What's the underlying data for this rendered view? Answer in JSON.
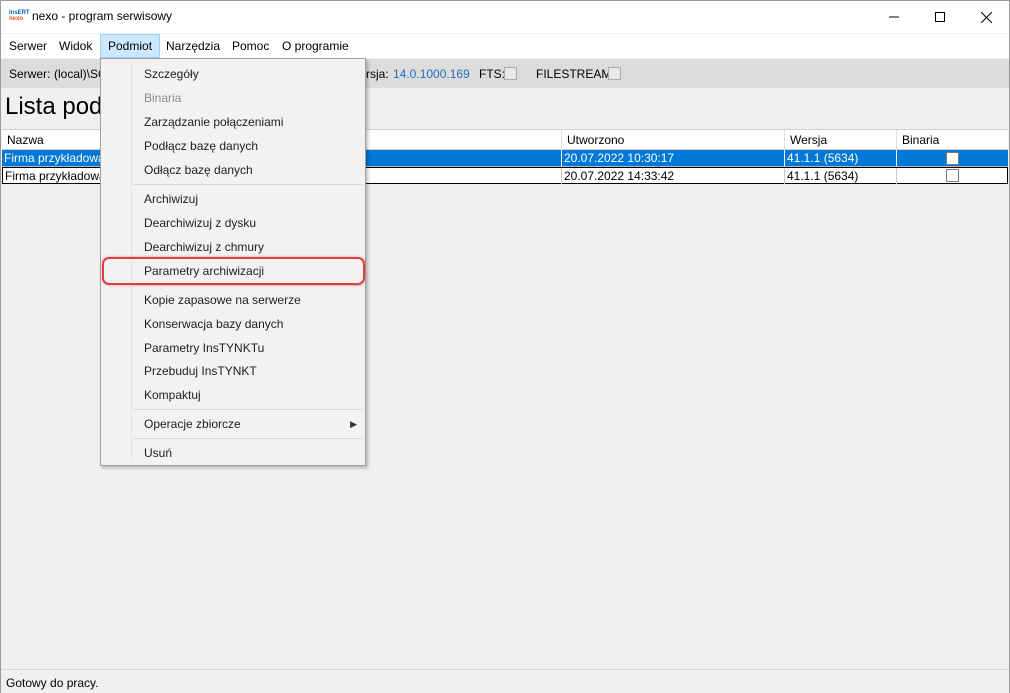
{
  "window": {
    "title": "nexo - program serwisowy",
    "logo_top": "InsERT",
    "logo_bottom": "nexo"
  },
  "menubar": {
    "items": [
      {
        "label": "Serwer"
      },
      {
        "label": "Widok"
      },
      {
        "label": "Podmiot",
        "active": true
      },
      {
        "label": "Narzędzia"
      },
      {
        "label": "Pomoc"
      },
      {
        "label": "O programie"
      }
    ]
  },
  "infobar": {
    "server_label": "Serwer:",
    "server_value": "(local)\\SQ",
    "version_label": "rsja:",
    "version_value": "14.0.1000.169",
    "fts_label": "FTS:",
    "filestream_label": "FILESTREAM:"
  },
  "page_title": "Lista pod",
  "table": {
    "columns": [
      "Nazwa",
      "Utworzono",
      "Wersja",
      "Binaria"
    ],
    "rows": [
      {
        "nazwa": "Firma przykładowa",
        "utworzono": "20.07.2022 10:30:17",
        "wersja": "41.1.1 (5634)",
        "binaria": false,
        "selected": true
      },
      {
        "nazwa": "Firma przykładowa",
        "utworzono": "20.07.2022 14:33:42",
        "wersja": "41.1.1 (5634)",
        "binaria": false,
        "selected": false
      }
    ]
  },
  "dropdown": {
    "items": [
      {
        "label": "Szczegóły"
      },
      {
        "label": "Binaria",
        "disabled": true
      },
      {
        "label": "Zarządzanie połączeniami"
      },
      {
        "label": "Podłącz bazę danych"
      },
      {
        "label": "Odłącz bazę danych"
      },
      {
        "label": "Archiwizuj"
      },
      {
        "label": "Dearchiwizuj z dysku"
      },
      {
        "label": "Dearchiwizuj z chmury"
      },
      {
        "label": "Parametry archiwizacji",
        "highlighted": true
      },
      {
        "label": "Kopie zapasowe na serwerze"
      },
      {
        "label": "Konserwacja bazy danych"
      },
      {
        "label": "Parametry InsTYNKTu"
      },
      {
        "label": "Przebuduj InsTYNKT"
      },
      {
        "label": "Kompaktuj"
      },
      {
        "label": "Operacje zbiorcze",
        "submenu": true
      },
      {
        "label": "Usuń"
      }
    ]
  },
  "status": {
    "text": "Gotowy do pracy."
  },
  "colors": {
    "accent": "#0078d7",
    "highlight_border": "#e23d3d",
    "menu_active": "#cce8ff",
    "link": "#1f6fbf"
  }
}
